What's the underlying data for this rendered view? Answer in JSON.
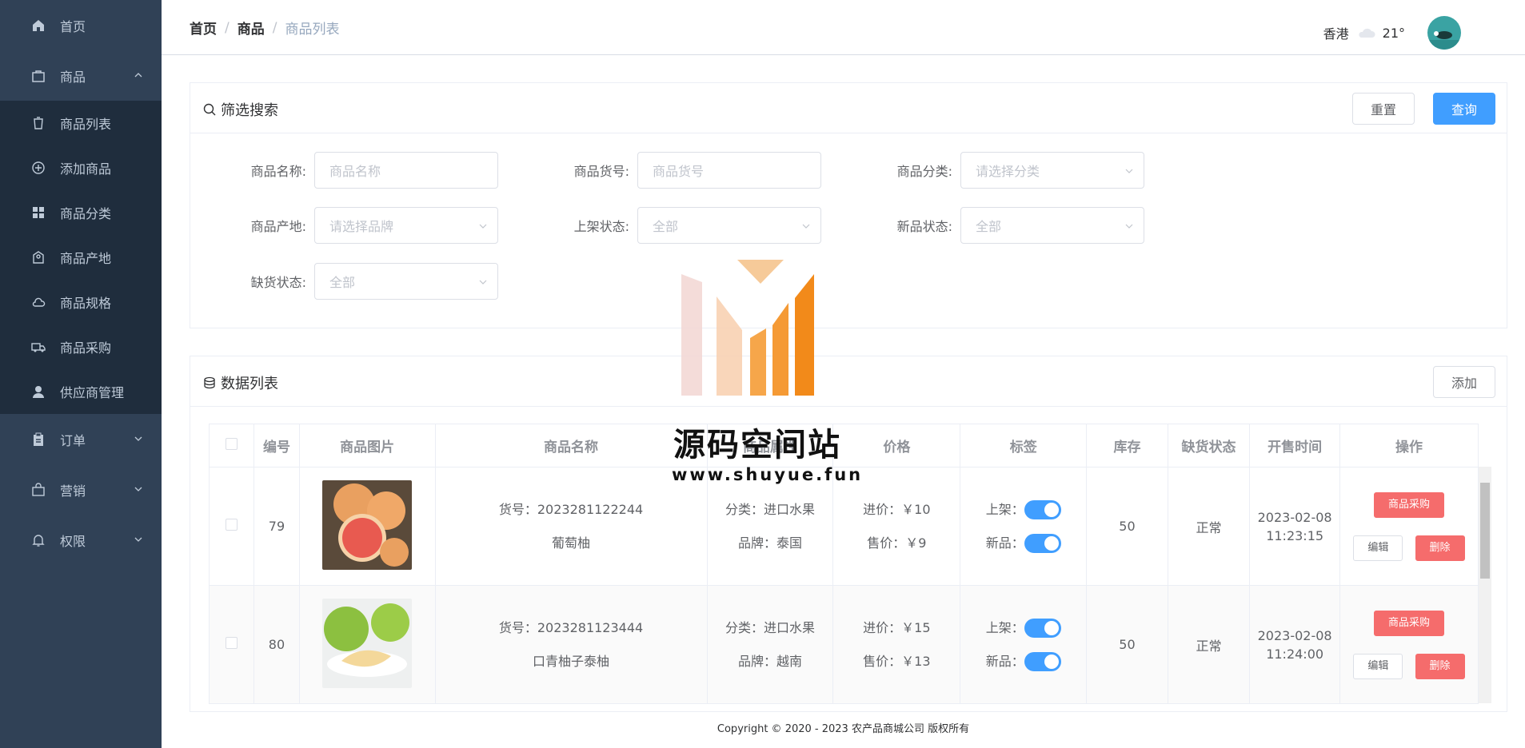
{
  "sidebar": {
    "home": "首页",
    "goods": "商品",
    "sub": [
      "商品列表",
      "添加商品",
      "商品分类",
      "商品产地",
      "商品规格",
      "商品采购",
      "供应商管理"
    ],
    "order": "订单",
    "marketing": "营销",
    "permission": "权限"
  },
  "breadcrumb": [
    "首页",
    "商品",
    "商品列表"
  ],
  "weather": {
    "city": "香港",
    "temp": "21°"
  },
  "filter": {
    "title": "筛选搜索",
    "reset": "重置",
    "query": "查询",
    "fields": [
      {
        "label": "商品名称:",
        "placeholder": "商品名称"
      },
      {
        "label": "商品货号:",
        "placeholder": "商品货号"
      },
      {
        "label": "商品分类:",
        "placeholder": "请选择分类"
      },
      {
        "label": "商品产地:",
        "placeholder": "请选择品牌"
      },
      {
        "label": "上架状态:",
        "placeholder": "全部"
      },
      {
        "label": "新品状态:",
        "placeholder": "全部"
      },
      {
        "label": "缺货状态:",
        "placeholder": "全部"
      }
    ]
  },
  "list": {
    "title": "数据列表",
    "add": "添加",
    "headers": [
      "编号",
      "商品图片",
      "商品名称",
      "商品属性",
      "价格",
      "标签",
      "库存",
      "缺货状态",
      "开售时间",
      "操作"
    ],
    "rows": [
      {
        "id": "79",
        "sku": "货号：2023281122244",
        "name": "葡萄柚",
        "category": "分类：进口水果",
        "brand": "品牌：泰国",
        "cost": "进价：￥10",
        "price": "售价：￥9",
        "shelf": "上架：",
        "new": "新品：",
        "stock": "50",
        "status": "正常",
        "date": "2023-02-08",
        "time": "11:23:15"
      },
      {
        "id": "80",
        "sku": "货号：2023281123444",
        "name": "口青柚子泰柚",
        "category": "分类：进口水果",
        "brand": "品牌：越南",
        "cost": "进价：￥15",
        "price": "售价：￥13",
        "shelf": "上架：",
        "new": "新品：",
        "stock": "50",
        "status": "正常",
        "date": "2023-02-08",
        "time": "11:24:00"
      }
    ],
    "actions": {
      "buy": "商品采购",
      "edit": "编辑",
      "delete": "删除"
    }
  },
  "watermark": {
    "title": "源码空间站",
    "url": "www.shuyue.fun"
  },
  "footer": "Copyright © 2020 - 2023  农产品商城公司 版权所有"
}
